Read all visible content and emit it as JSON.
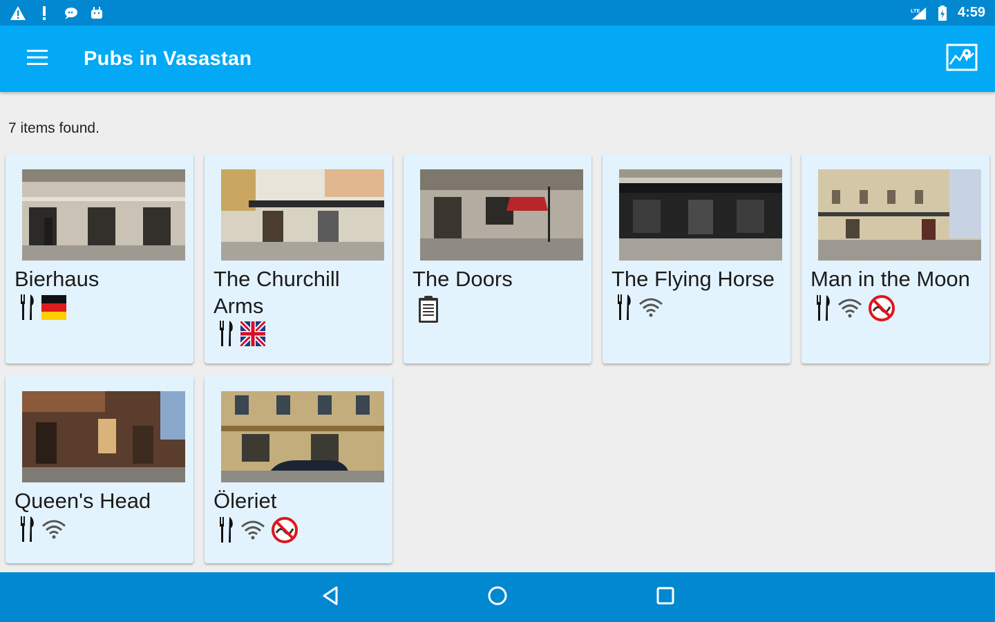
{
  "status_bar": {
    "time": "4:59",
    "left_icons": [
      "warning-icon",
      "alert-icon",
      "chat-icon",
      "android-icon"
    ],
    "right_icons": [
      "signal-icon",
      "battery-icon"
    ]
  },
  "app_bar": {
    "title": "Pubs in  Vasastan",
    "menu_icon": "hamburger-menu-icon",
    "action_icon": "map-icon"
  },
  "results": {
    "count_text": "7 items found."
  },
  "pubs": [
    {
      "name": "Bierhaus",
      "amenities": [
        "restaurant-icon",
        "germany-flag-icon"
      ]
    },
    {
      "name": "The Churchill Arms",
      "amenities": [
        "restaurant-icon",
        "uk-flag-icon"
      ]
    },
    {
      "name": "The Doors",
      "amenities": [
        "clipboard-icon"
      ]
    },
    {
      "name": "The Flying Horse",
      "amenities": [
        "restaurant-icon",
        "wifi-icon"
      ]
    },
    {
      "name": "Man in the Moon",
      "amenities": [
        "restaurant-icon",
        "wifi-icon",
        "no-smoking-icon"
      ]
    },
    {
      "name": "Queen's Head",
      "amenities": [
        "restaurant-icon",
        "wifi-icon"
      ]
    },
    {
      "name": "Öleriet",
      "amenities": [
        "restaurant-icon",
        "wifi-icon",
        "no-smoking-icon"
      ]
    }
  ],
  "nav_bar": {
    "icons": [
      "back-icon",
      "home-icon",
      "recents-icon"
    ]
  },
  "colors": {
    "status_bar": "#0288d1",
    "app_bar": "#03a9f4",
    "card_background": "#e3f3fd",
    "page_background": "#eeeeee"
  }
}
